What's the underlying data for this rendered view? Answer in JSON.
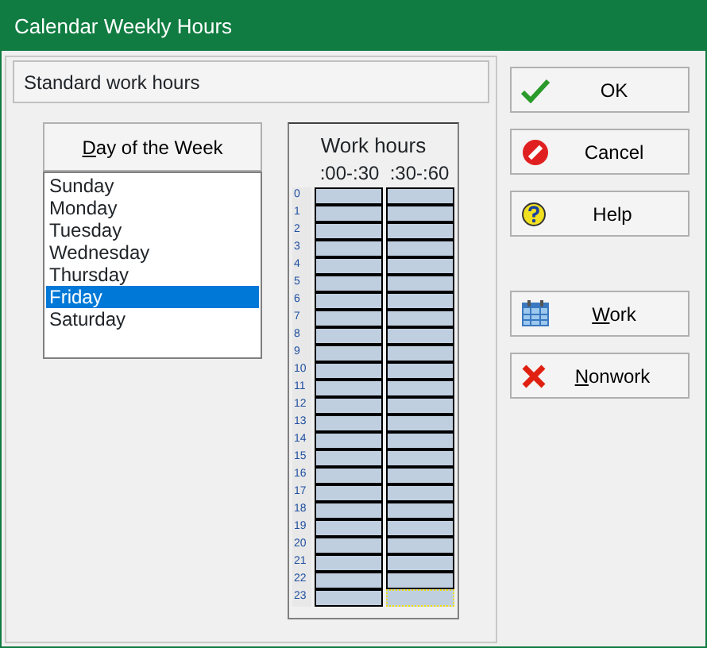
{
  "window": {
    "title": "Calendar Weekly Hours"
  },
  "section_title": "Standard work hours",
  "day_header": {
    "key": "D",
    "rest": "ay of the Week"
  },
  "days": [
    {
      "label": "Sunday",
      "selected": false
    },
    {
      "label": "Monday",
      "selected": false
    },
    {
      "label": "Tuesday",
      "selected": false
    },
    {
      "label": "Wednesday",
      "selected": false
    },
    {
      "label": "Thursday",
      "selected": false
    },
    {
      "label": "Friday",
      "selected": true
    },
    {
      "label": "Saturday",
      "selected": false
    }
  ],
  "work_hours": {
    "title": "Work hours",
    "columns": [
      ":00-:30",
      ":30-:60"
    ],
    "rows": [
      {
        "hour": "0",
        "slots": [
          {
            "focused": false
          },
          {
            "focused": false
          }
        ]
      },
      {
        "hour": "1",
        "slots": [
          {
            "focused": false
          },
          {
            "focused": false
          }
        ]
      },
      {
        "hour": "2",
        "slots": [
          {
            "focused": false
          },
          {
            "focused": false
          }
        ]
      },
      {
        "hour": "3",
        "slots": [
          {
            "focused": false
          },
          {
            "focused": false
          }
        ]
      },
      {
        "hour": "4",
        "slots": [
          {
            "focused": false
          },
          {
            "focused": false
          }
        ]
      },
      {
        "hour": "5",
        "slots": [
          {
            "focused": false
          },
          {
            "focused": false
          }
        ]
      },
      {
        "hour": "6",
        "slots": [
          {
            "focused": false
          },
          {
            "focused": false
          }
        ]
      },
      {
        "hour": "7",
        "slots": [
          {
            "focused": false
          },
          {
            "focused": false
          }
        ]
      },
      {
        "hour": "8",
        "slots": [
          {
            "focused": false
          },
          {
            "focused": false
          }
        ]
      },
      {
        "hour": "9",
        "slots": [
          {
            "focused": false
          },
          {
            "focused": false
          }
        ]
      },
      {
        "hour": "10",
        "slots": [
          {
            "focused": false
          },
          {
            "focused": false
          }
        ]
      },
      {
        "hour": "11",
        "slots": [
          {
            "focused": false
          },
          {
            "focused": false
          }
        ]
      },
      {
        "hour": "12",
        "slots": [
          {
            "focused": false
          },
          {
            "focused": false
          }
        ]
      },
      {
        "hour": "13",
        "slots": [
          {
            "focused": false
          },
          {
            "focused": false
          }
        ]
      },
      {
        "hour": "14",
        "slots": [
          {
            "focused": false
          },
          {
            "focused": false
          }
        ]
      },
      {
        "hour": "15",
        "slots": [
          {
            "focused": false
          },
          {
            "focused": false
          }
        ]
      },
      {
        "hour": "16",
        "slots": [
          {
            "focused": false
          },
          {
            "focused": false
          }
        ]
      },
      {
        "hour": "17",
        "slots": [
          {
            "focused": false
          },
          {
            "focused": false
          }
        ]
      },
      {
        "hour": "18",
        "slots": [
          {
            "focused": false
          },
          {
            "focused": false
          }
        ]
      },
      {
        "hour": "19",
        "slots": [
          {
            "focused": false
          },
          {
            "focused": false
          }
        ]
      },
      {
        "hour": "20",
        "slots": [
          {
            "focused": false
          },
          {
            "focused": false
          }
        ]
      },
      {
        "hour": "21",
        "slots": [
          {
            "focused": false
          },
          {
            "focused": false
          }
        ]
      },
      {
        "hour": "22",
        "slots": [
          {
            "focused": false
          },
          {
            "focused": false
          }
        ]
      },
      {
        "hour": "23",
        "slots": [
          {
            "focused": false
          },
          {
            "focused": true
          }
        ]
      }
    ]
  },
  "buttons": [
    {
      "kind": "ok",
      "label": "OK"
    },
    {
      "kind": "cancel",
      "label": "Cancel"
    },
    {
      "kind": "help",
      "label": "Help"
    },
    {
      "kind": "work",
      "key": "W",
      "label": "ork"
    },
    {
      "kind": "nonwork",
      "key": "N",
      "label": "onwork"
    }
  ]
}
